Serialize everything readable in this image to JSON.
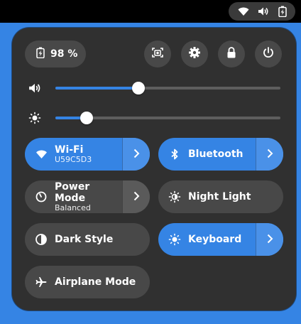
{
  "tray": {
    "icons": [
      "wifi-icon",
      "volume-icon",
      "battery-charging-icon"
    ]
  },
  "battery": {
    "percent_label": "98 %",
    "icon": "battery-charging-icon"
  },
  "header_buttons": [
    {
      "name": "screenshot-button",
      "icon": "screenshot-icon"
    },
    {
      "name": "settings-button",
      "icon": "gear-icon"
    },
    {
      "name": "lock-button",
      "icon": "lock-icon"
    },
    {
      "name": "power-button",
      "icon": "power-icon"
    }
  ],
  "sliders": {
    "volume": {
      "icon": "volume-icon",
      "level": 0.37
    },
    "brightness": {
      "icon": "brightness-icon",
      "level": 0.14
    }
  },
  "tiles": {
    "wifi": {
      "title": "Wi-Fi",
      "subtitle": "U59C5D3",
      "active": true,
      "icon": "wifi-icon"
    },
    "bluetooth": {
      "title": "Bluetooth",
      "active": true,
      "icon": "bluetooth-icon"
    },
    "power_mode": {
      "title": "Power Mode",
      "subtitle": "Balanced",
      "active": false,
      "icon": "power-mode-icon"
    },
    "night_light": {
      "title": "Night Light",
      "active": false,
      "icon": "night-light-icon"
    },
    "dark_style": {
      "title": "Dark Style",
      "active": false,
      "icon": "dark-style-icon"
    },
    "keyboard": {
      "title": "Keyboard",
      "active": true,
      "icon": "keyboard-brightness-icon"
    },
    "airplane": {
      "title": "Airplane Mode",
      "active": false,
      "icon": "airplane-icon"
    }
  },
  "colors": {
    "accent": "#3584e4",
    "panel": "#303030",
    "tile_inactive": "#484848"
  }
}
